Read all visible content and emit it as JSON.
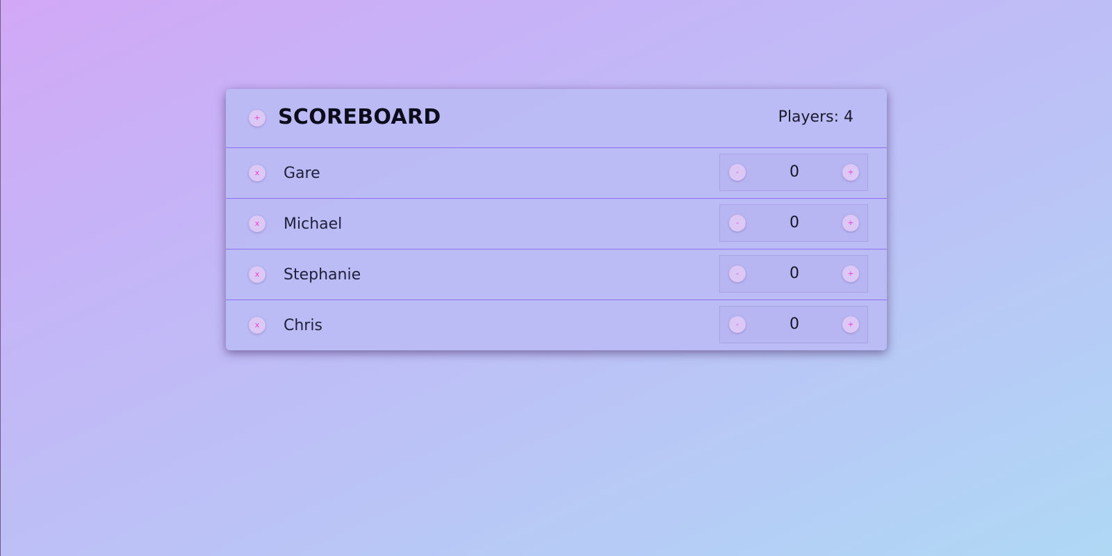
{
  "header": {
    "add_label": "+",
    "title": "SCOREBOARD",
    "players_count": "Players: 4"
  },
  "players": [
    {
      "name": "Gare",
      "score": "0",
      "remove_label": "x",
      "dec_label": "-",
      "inc_label": "+"
    },
    {
      "name": "Michael",
      "score": "0",
      "remove_label": "x",
      "dec_label": "-",
      "inc_label": "+"
    },
    {
      "name": "Stephanie",
      "score": "0",
      "remove_label": "x",
      "dec_label": "-",
      "inc_label": "+"
    },
    {
      "name": "Chris",
      "score": "0",
      "remove_label": "x",
      "dec_label": "-",
      "inc_label": "+"
    }
  ],
  "colors": {
    "accent": "#e83fd9",
    "divider": "#8f6ef0",
    "button_bg": "#dcc7f5"
  }
}
